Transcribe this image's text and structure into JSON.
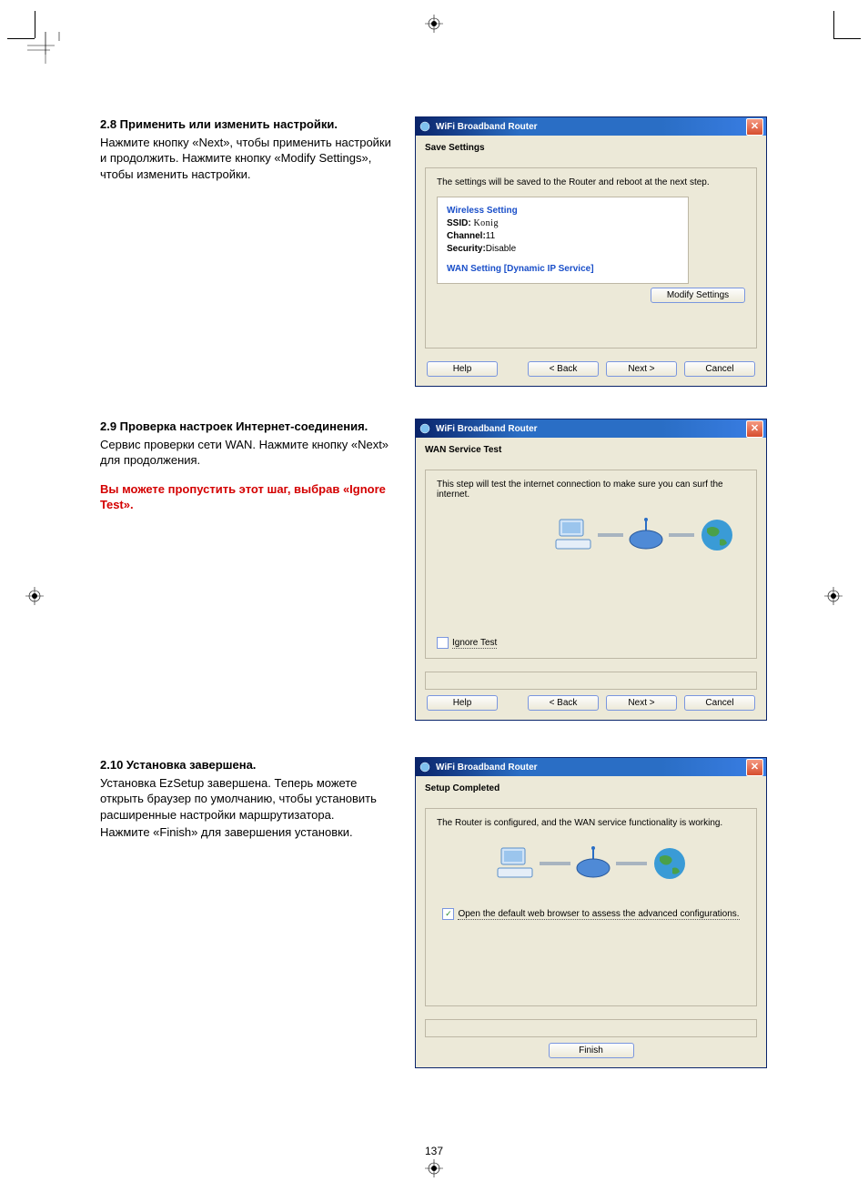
{
  "page_number": "137",
  "section28": {
    "heading": "2.8 Применить или изменить настройки.",
    "body": "Нажмите кнопку «Next», чтобы применить настройки и продолжить. Нажмите кнопку «Modify Settings», чтобы изменить настройки."
  },
  "section29": {
    "heading": "2.9 Проверка настроек Интернет-соединения.",
    "body": "Сервис проверки сети WAN. Нажмите кнопку «Next» для продолжения.",
    "red_note": "Вы можете пропустить этот шаг, выбрав «Ignore Test»."
  },
  "section210": {
    "heading": "2.10 Установка завершена.",
    "body1": "Установка EzSetup завершена. Теперь можете открыть браузер по умолчанию, чтобы установить расширенные настройки маршрутизатора.",
    "body2": "Нажмите «Finish» для завершения установки."
  },
  "dialog1": {
    "title": "WiFi Broadband Router",
    "section_title": "Save Settings",
    "panel_text": "The settings will be saved to the Router and reboot at the next step.",
    "wireless_heading": "Wireless Setting",
    "ssid_label": "SSID:",
    "ssid_value": "Konig",
    "channel_label": "Channel:",
    "channel_value": "11",
    "security_label": "Security:",
    "security_value": "Disable",
    "wan_heading": "WAN Setting  [Dynamic IP Service]",
    "modify_button": "Modify Settings",
    "help": "Help",
    "back": "< Back",
    "next": "Next >",
    "cancel": "Cancel"
  },
  "dialog2": {
    "title": "WiFi Broadband Router",
    "section_title": "WAN Service Test",
    "panel_text": "This step will test the internet connection to make sure you can surf the internet.",
    "ignore_test": "Ignore Test",
    "help": "Help",
    "back": "< Back",
    "next": "Next >",
    "cancel": "Cancel"
  },
  "dialog3": {
    "title": "WiFi Broadband Router",
    "section_title": "Setup Completed",
    "panel_text": "The Router is configured, and the WAN service functionality is working.",
    "open_browser": "Open the default web browser to assess the advanced configurations.",
    "finish": "Finish"
  }
}
